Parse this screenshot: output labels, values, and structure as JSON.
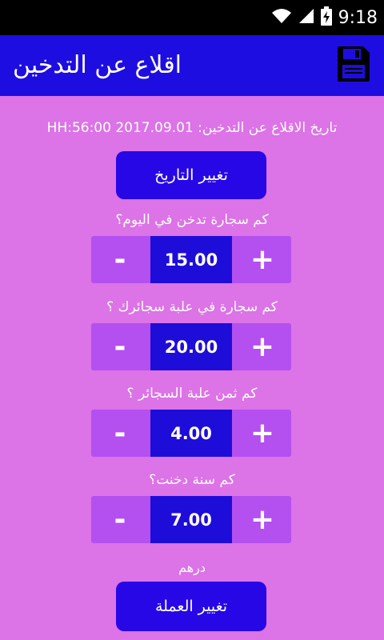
{
  "status_bar": {
    "time": "9:18",
    "icons": [
      "wifi-icon",
      "signal-icon",
      "battery-charging-icon"
    ]
  },
  "app_bar": {
    "title": "اقلاع عن التدخين",
    "save_icon": "save-icon"
  },
  "quit_date": {
    "text": "تاريخ الاقلاع عن التدخين: 2017.09.01 HH:56:00"
  },
  "change_date_button": "تغيير التاريخ",
  "fields": [
    {
      "question": "كم سجارة تدخن في اليوم؟",
      "value": "15.00",
      "minus": "-",
      "plus": "+"
    },
    {
      "question": "كم سجارة في علبة سجائرك ؟",
      "value": "20.00",
      "minus": "-",
      "plus": "+"
    },
    {
      "question": "كم ثمن علبة السجائر ؟",
      "value": "4.00",
      "minus": "-",
      "plus": "+"
    },
    {
      "question": "كم سنة دخنت؟",
      "value": "7.00",
      "minus": "-",
      "plus": "+"
    }
  ],
  "currency": {
    "label": "درهم",
    "change_button": "تغيير العملة"
  },
  "colors": {
    "background": "#dc73e6",
    "app_bar": "#1e0de0",
    "button": "#2807e6",
    "stepper": "#b44ff0",
    "stepper_value": "#1e0dd8"
  }
}
